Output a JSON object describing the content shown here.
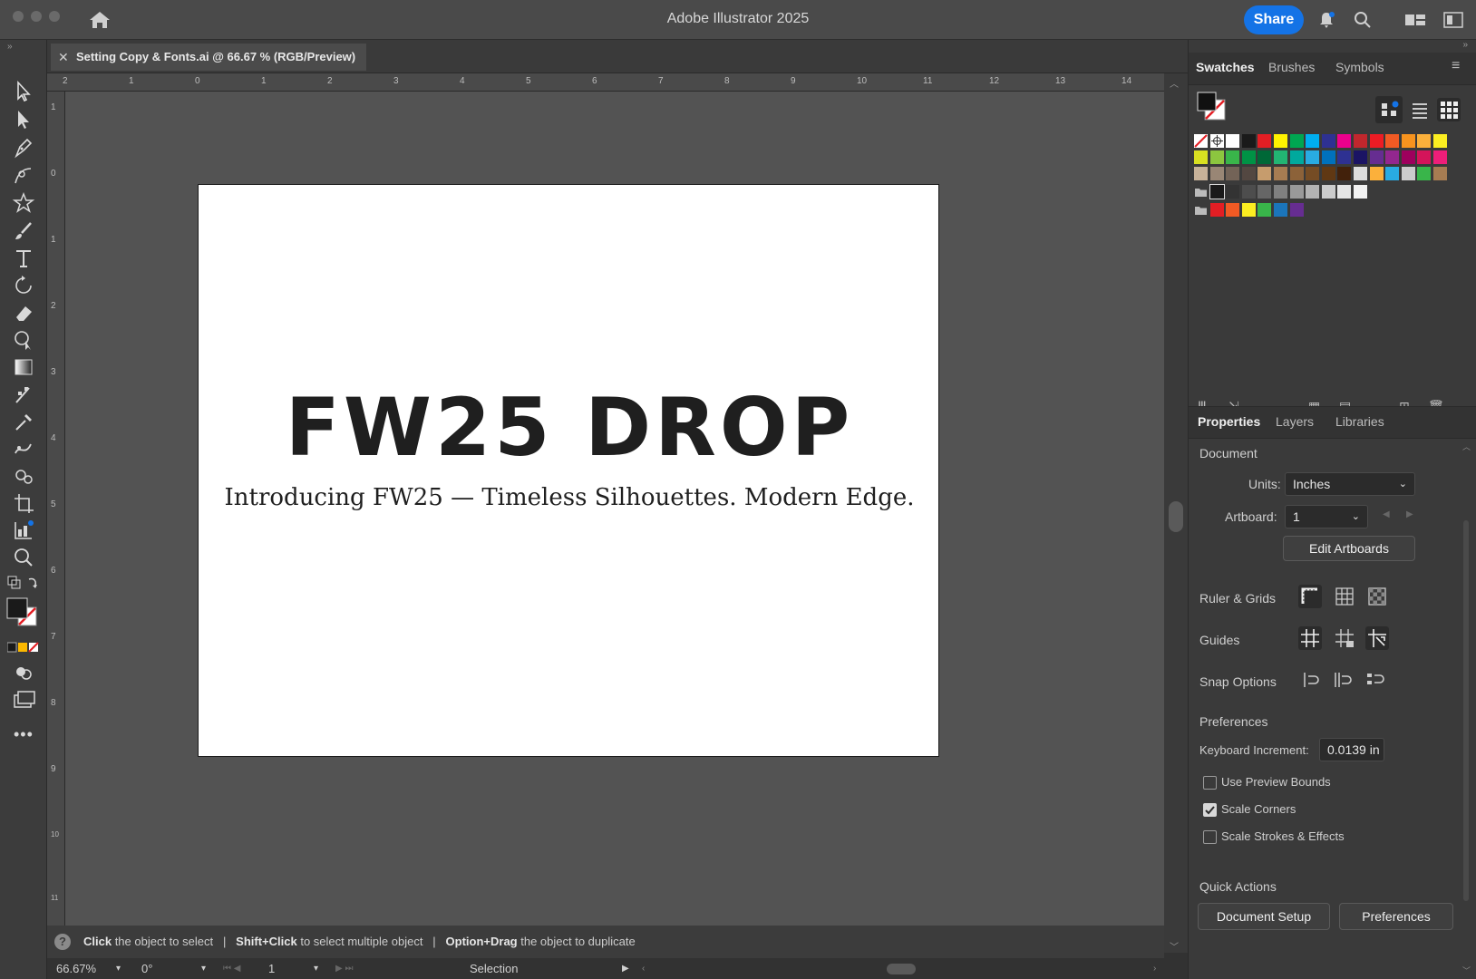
{
  "window": {
    "title": "Adobe Illustrator 2025",
    "share_label": "Share"
  },
  "document": {
    "tab_title": "Setting Copy & Fonts.ai @ 66.67 % (RGB/Preview)"
  },
  "artboard": {
    "headline": "FW25 DROP",
    "subline": "Introducing FW25 — Timeless Silhouettes. Modern Edge."
  },
  "ruler": {
    "top_labels": [
      "2",
      "1",
      "0",
      "1",
      "2",
      "3",
      "4",
      "5",
      "6",
      "7",
      "8",
      "9",
      "10",
      "11",
      "12",
      "13",
      "14"
    ],
    "left_labels": [
      "1",
      "0",
      "1",
      "2",
      "3",
      "4",
      "5",
      "6",
      "7",
      "8",
      "9",
      "10",
      "11"
    ]
  },
  "hints": {
    "h1_key": "Click",
    "h1_text": " the object to select",
    "h2_key": "Shift+Click",
    "h2_text": " to select multiple object",
    "h3_key": "Option+Drag",
    "h3_text": " the object to duplicate",
    "sep": "|"
  },
  "status": {
    "zoom": "66.67%",
    "rotation": "0°",
    "artboard_num": "1",
    "tool": "Selection"
  },
  "swatches_panel": {
    "tabs": [
      "Swatches",
      "Brushes",
      "Symbols"
    ],
    "rows": [
      [
        "#ffffff",
        "#ffffff",
        "#ffffff",
        "#1a1a1a",
        "#e31e24",
        "#fff200",
        "#00a651",
        "#00aeef",
        "#2e3192",
        "#ec008c",
        "#c1272d",
        "#ed1c24",
        "#f15a24",
        "#f7931e",
        "#fbb03b",
        "#fcee21"
      ],
      [
        "#d9e021",
        "#8cc63f",
        "#39b54a",
        "#009245",
        "#006837",
        "#22b573",
        "#00a99d",
        "#29abe2",
        "#0071bc",
        "#2e3192",
        "#1b1464",
        "#662d91",
        "#93278f",
        "#9e005d",
        "#d4145a",
        "#ed1e79"
      ],
      [
        "#c7b299",
        "#998675",
        "#736357",
        "#534741",
        "#c69c6d",
        "#a67c52",
        "#8c6239",
        "#754c24",
        "#603813",
        "#42210b",
        "#dddddd",
        "#fbb03b",
        "#29abe2",
        "#cccccc",
        "#39b54a",
        "#a67c52"
      ],
      [
        "#ffffff",
        "#1a1a1a",
        "#333333",
        "#4d4d4d",
        "#666666",
        "#808080",
        "#999999",
        "#b3b3b3",
        "#cccccc",
        "#e6e6e6",
        "#f2f2f2"
      ],
      [
        "#ffffff",
        "#e31e24",
        "#f15a24",
        "#fcee21",
        "#39b54a",
        "#1b75bb",
        "#662d91"
      ]
    ]
  },
  "properties_panel": {
    "tabs": [
      "Properties",
      "Layers",
      "Libraries"
    ],
    "section_document": "Document",
    "units_label": "Units:",
    "units_value": "Inches",
    "artboard_label": "Artboard:",
    "artboard_value": "1",
    "edit_artboards": "Edit Artboards",
    "ruler_grids": "Ruler & Grids",
    "guides": "Guides",
    "snap_options": "Snap Options",
    "preferences_title": "Preferences",
    "keyboard_increment_label": "Keyboard Increment:",
    "keyboard_increment_value": "0.0139 in",
    "use_preview_bounds": "Use Preview Bounds",
    "scale_corners": "Scale Corners",
    "scale_strokes": "Scale Strokes & Effects",
    "quick_actions": "Quick Actions",
    "document_setup": "Document Setup",
    "preferences_btn": "Preferences"
  }
}
